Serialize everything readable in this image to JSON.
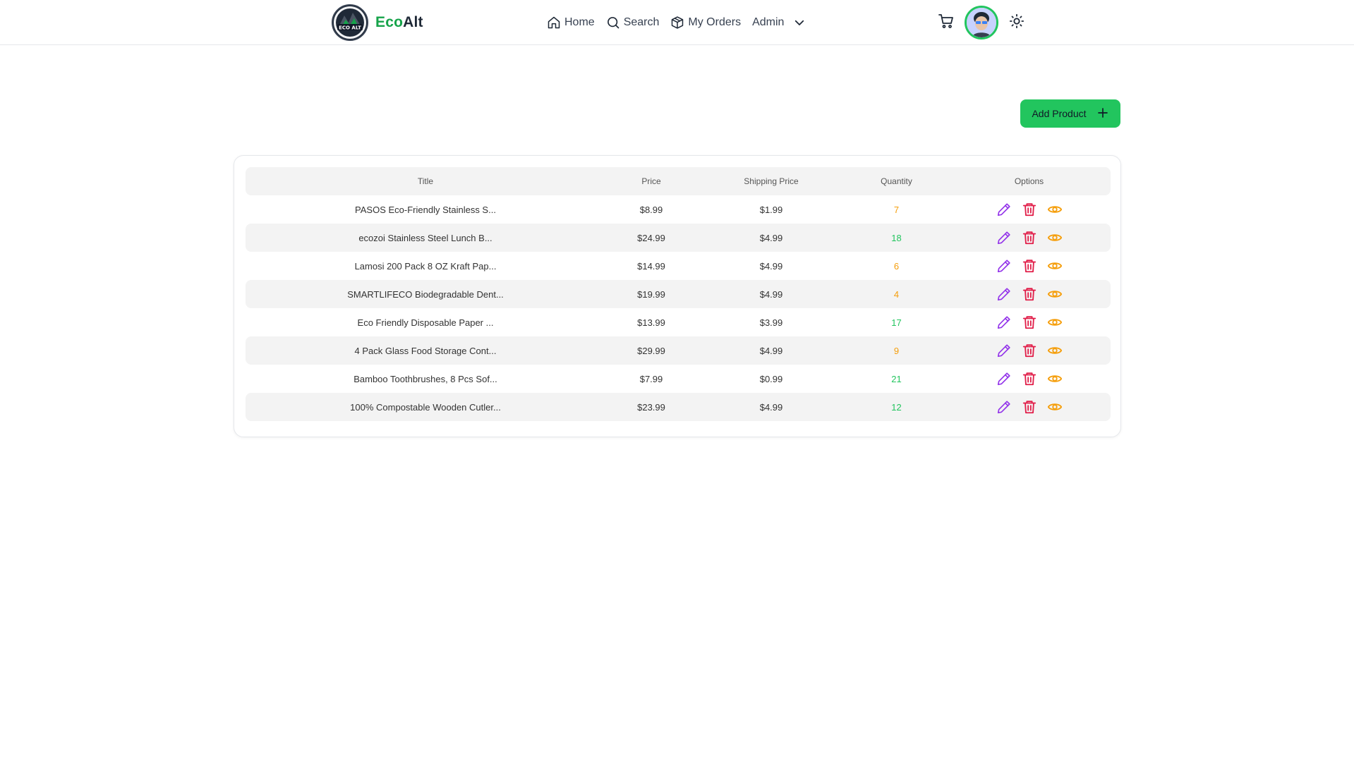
{
  "brand": {
    "eco": "Eco",
    "alt": "Alt",
    "logo_icon": "eco-alt-logo"
  },
  "nav": {
    "home": "Home",
    "search": "Search",
    "orders": "My Orders",
    "admin": "Admin"
  },
  "actions": {
    "add_product": "Add Product"
  },
  "table": {
    "headers": {
      "title": "Title",
      "price": "Price",
      "shipping": "Shipping Price",
      "quantity": "Quantity",
      "options": "Options"
    },
    "rows": [
      {
        "title": "PASOS Eco-Friendly Stainless S...",
        "price": "$8.99",
        "shipping": "$1.99",
        "quantity": "7"
      },
      {
        "title": "ecozoi Stainless Steel Lunch B...",
        "price": "$24.99",
        "shipping": "$4.99",
        "quantity": "18"
      },
      {
        "title": "Lamosi 200 Pack 8 OZ Kraft Pap...",
        "price": "$14.99",
        "shipping": "$4.99",
        "quantity": "6"
      },
      {
        "title": "SMARTLIFECO Biodegradable Dent...",
        "price": "$19.99",
        "shipping": "$4.99",
        "quantity": "4"
      },
      {
        "title": "Eco Friendly Disposable Paper ...",
        "price": "$13.99",
        "shipping": "$3.99",
        "quantity": "17"
      },
      {
        "title": "4 Pack Glass Food Storage Cont...",
        "price": "$29.99",
        "shipping": "$4.99",
        "quantity": "9"
      },
      {
        "title": "Bamboo Toothbrushes, 8 Pcs Sof...",
        "price": "$7.99",
        "shipping": "$0.99",
        "quantity": "21"
      },
      {
        "title": "100% Compostable Wooden Cutler...",
        "price": "$23.99",
        "shipping": "$4.99",
        "quantity": "12"
      }
    ]
  },
  "colors": {
    "accent": "#22c55e",
    "low_stock": "#f59e0b",
    "high_stock": "#22c55e",
    "edit": "#9333ea",
    "delete": "#e11d48",
    "view": "#f59e0b"
  }
}
